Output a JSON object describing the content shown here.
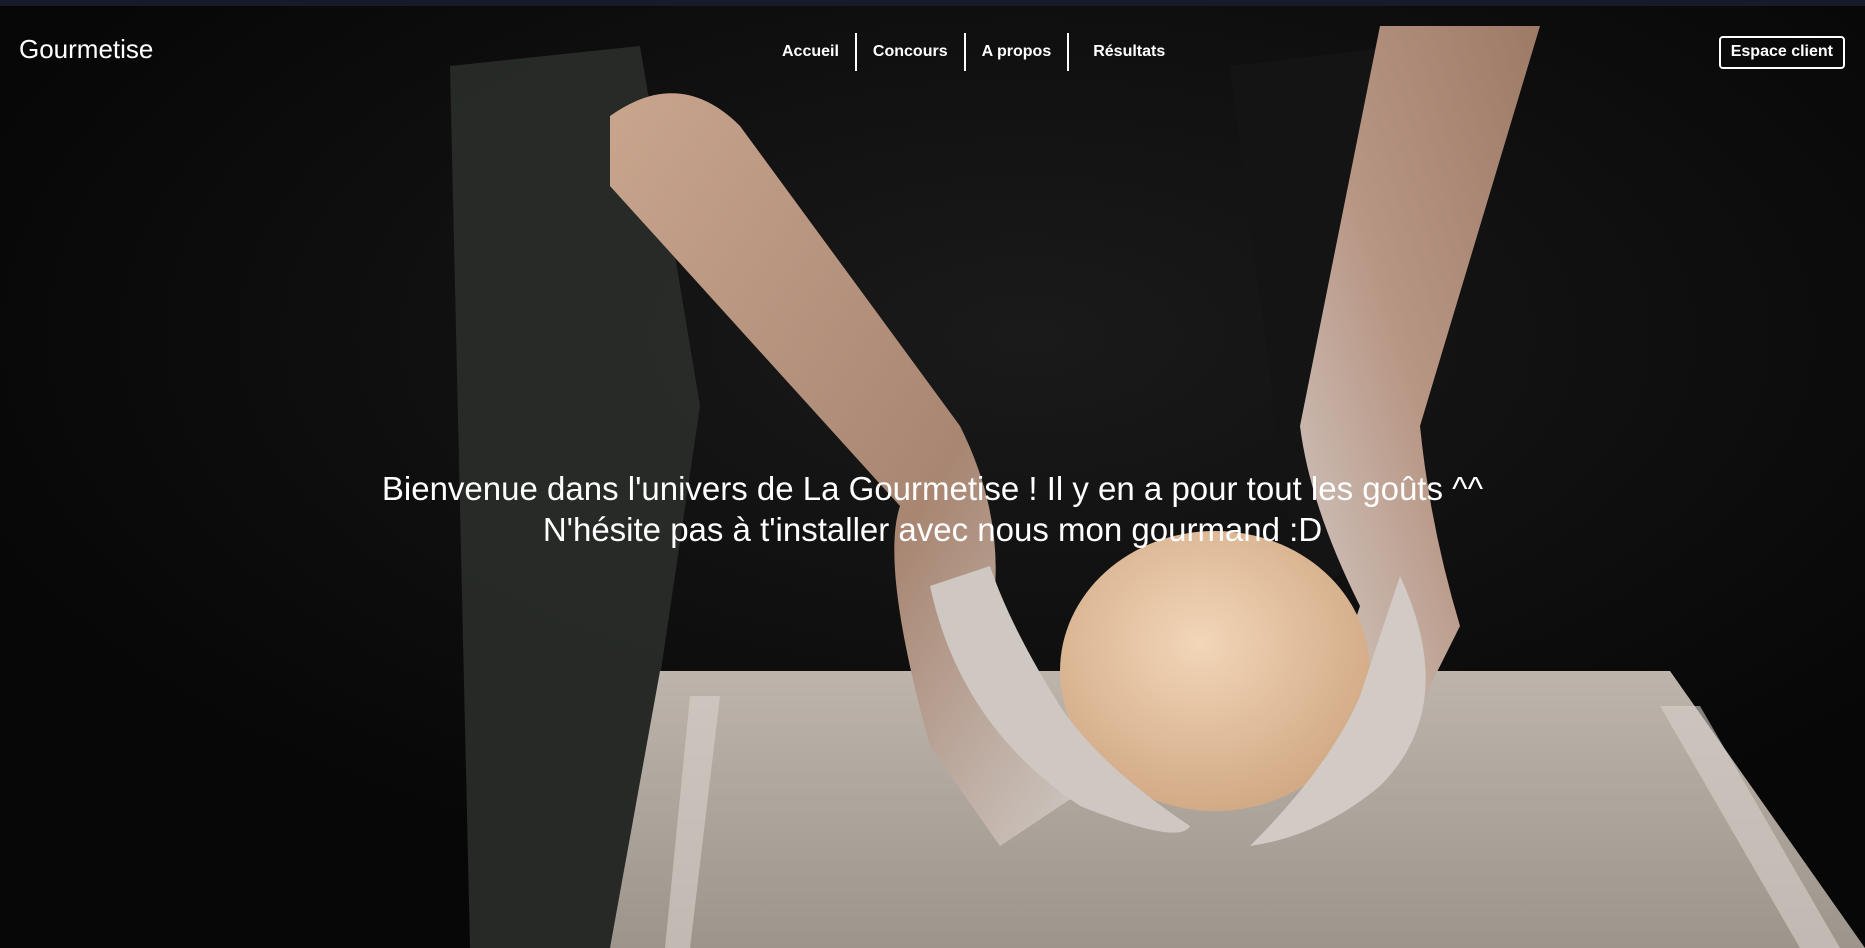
{
  "nav": {
    "brand": "Gourmetise",
    "items": [
      {
        "label": "Accueil"
      },
      {
        "label": "Concours"
      },
      {
        "label": "A propos"
      },
      {
        "label": "Résultats"
      }
    ],
    "client_button": "Espace client"
  },
  "hero": {
    "line1": "Bienvenue dans l'univers de La Gourmetise ! Il y en a pour tout les goûts ^^",
    "line2": "N'hésite pas à t'installer avec nous mon gourmand :D"
  },
  "colors": {
    "background": "#0c0c0c",
    "text": "#ffffff",
    "top_strip": "#161a2a"
  }
}
